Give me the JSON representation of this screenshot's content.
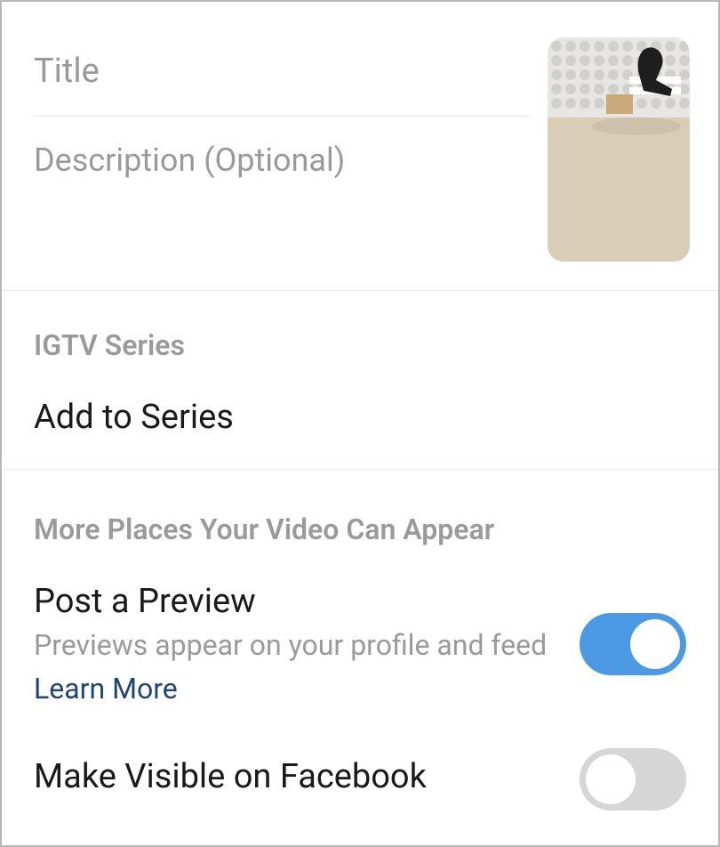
{
  "inputs": {
    "title_placeholder": "Title",
    "title_value": "",
    "description_placeholder": "Description (Optional)",
    "description_value": ""
  },
  "series": {
    "header": "IGTV Series",
    "action": "Add to Series"
  },
  "more": {
    "header": "More Places Your Video Can Appear",
    "preview": {
      "title": "Post a Preview",
      "subtitle": "Previews appear on your profile and feed",
      "learn_more": "Learn More",
      "toggle_on": true
    },
    "facebook": {
      "title": "Make Visible on Facebook",
      "toggle_on": false
    }
  },
  "colors": {
    "toggle_on": "#4a99e2",
    "toggle_off": "#d6d6d6",
    "text_muted": "#9a9a9a",
    "text_dark": "#1a1a1a",
    "link": "#1e4670"
  }
}
